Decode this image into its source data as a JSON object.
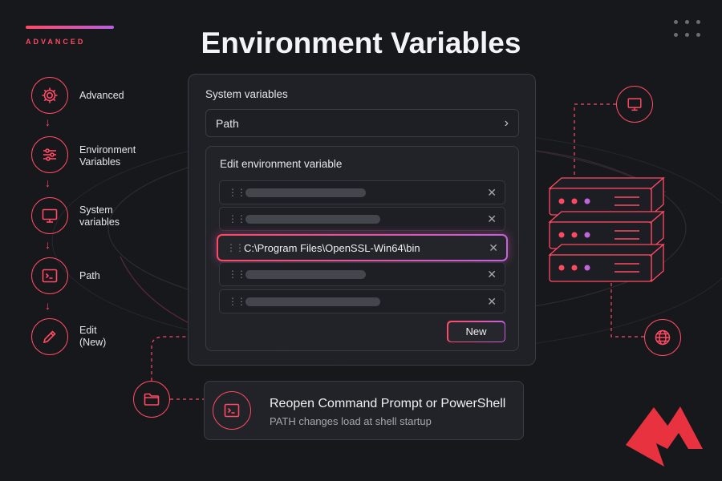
{
  "header": {
    "eyebrow": "ADVANCED",
    "title": "Environment Variables"
  },
  "steps": [
    {
      "label": "Advanced",
      "icon": "gear-icon"
    },
    {
      "label": "Environment Variables",
      "icon": "sliders-icon"
    },
    {
      "label": "System variables",
      "icon": "monitor-icon"
    },
    {
      "label": "Path",
      "icon": "terminal-icon"
    },
    {
      "label": "Edit (New)",
      "icon": "pencil-icon"
    }
  ],
  "system_variables": {
    "label": "System variables",
    "path_label": "Path"
  },
  "editor": {
    "title": "Edit environment variable",
    "rows": [
      {
        "value": "",
        "active": false
      },
      {
        "value": "",
        "active": false
      },
      {
        "value": "C:\\Program Files\\OpenSSL-Win64\\bin",
        "active": true
      },
      {
        "value": "",
        "active": false
      },
      {
        "value": "",
        "active": false
      }
    ],
    "new_button": "New"
  },
  "note": {
    "title": "Reopen Command Prompt or PowerShell",
    "subtitle": "PATH changes load at shell startup"
  },
  "colors": {
    "accent": "#ff4a62",
    "accent_purple": "#c463e0",
    "background": "#17181c"
  }
}
